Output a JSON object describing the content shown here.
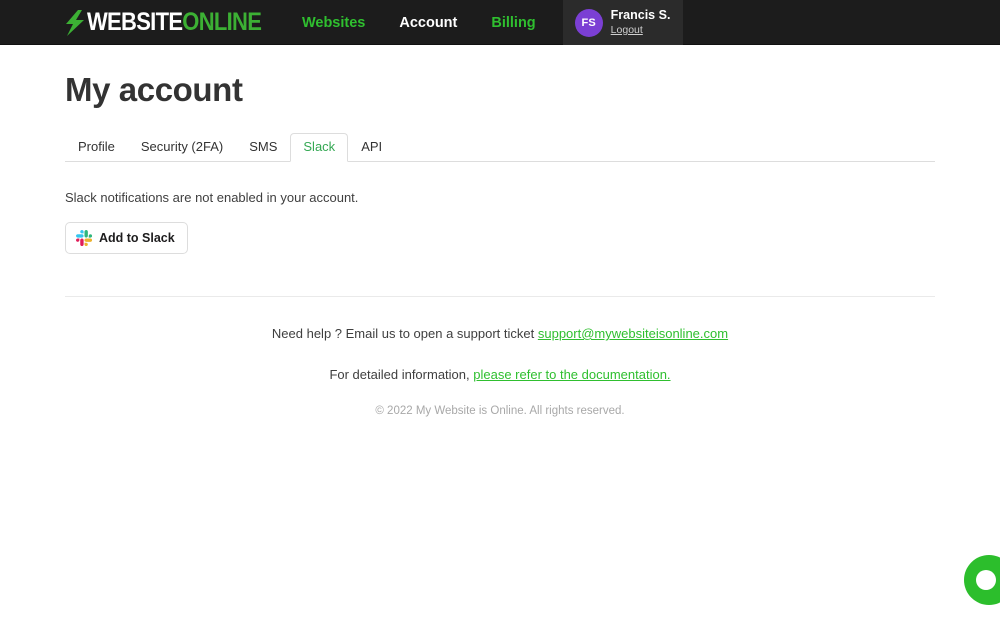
{
  "header": {
    "logo": {
      "icon": "lightning-bolt-icon",
      "text_primary": "WEBSITE",
      "text_secondary": "ONLINE"
    },
    "nav": [
      {
        "label": "Websites",
        "active": false
      },
      {
        "label": "Account",
        "active": true
      },
      {
        "label": "Billing",
        "active": false
      }
    ],
    "user": {
      "initials": "FS",
      "name": "Francis S.",
      "logout_label": "Logout",
      "avatar_color": "#7b3fd4"
    }
  },
  "page": {
    "title": "My account"
  },
  "tabs": [
    {
      "label": "Profile",
      "active": false
    },
    {
      "label": "Security (2FA)",
      "active": false
    },
    {
      "label": "SMS",
      "active": false
    },
    {
      "label": "Slack",
      "active": true
    },
    {
      "label": "API",
      "active": false
    }
  ],
  "main": {
    "status_text": "Slack notifications are not enabled in your account.",
    "add_to_slack_label": "Add to Slack"
  },
  "footer": {
    "help_prefix": "Need help ? Email us to open a support ticket",
    "support_email": "support@mywebsiteisonline.com",
    "docs_prefix": "For detailed information,",
    "docs_link": "please refer to the documentation.",
    "copyright": "© 2022 My Website is Online. All rights reserved."
  },
  "chat_widget": {
    "name": "chat-launcher",
    "color": "#2cbe2c"
  },
  "colors": {
    "accent_green": "#2fbf2f",
    "tab_active_green": "#34a853",
    "header_bg": "#1c1c1c",
    "user_panel_bg": "#2b2b2b"
  }
}
